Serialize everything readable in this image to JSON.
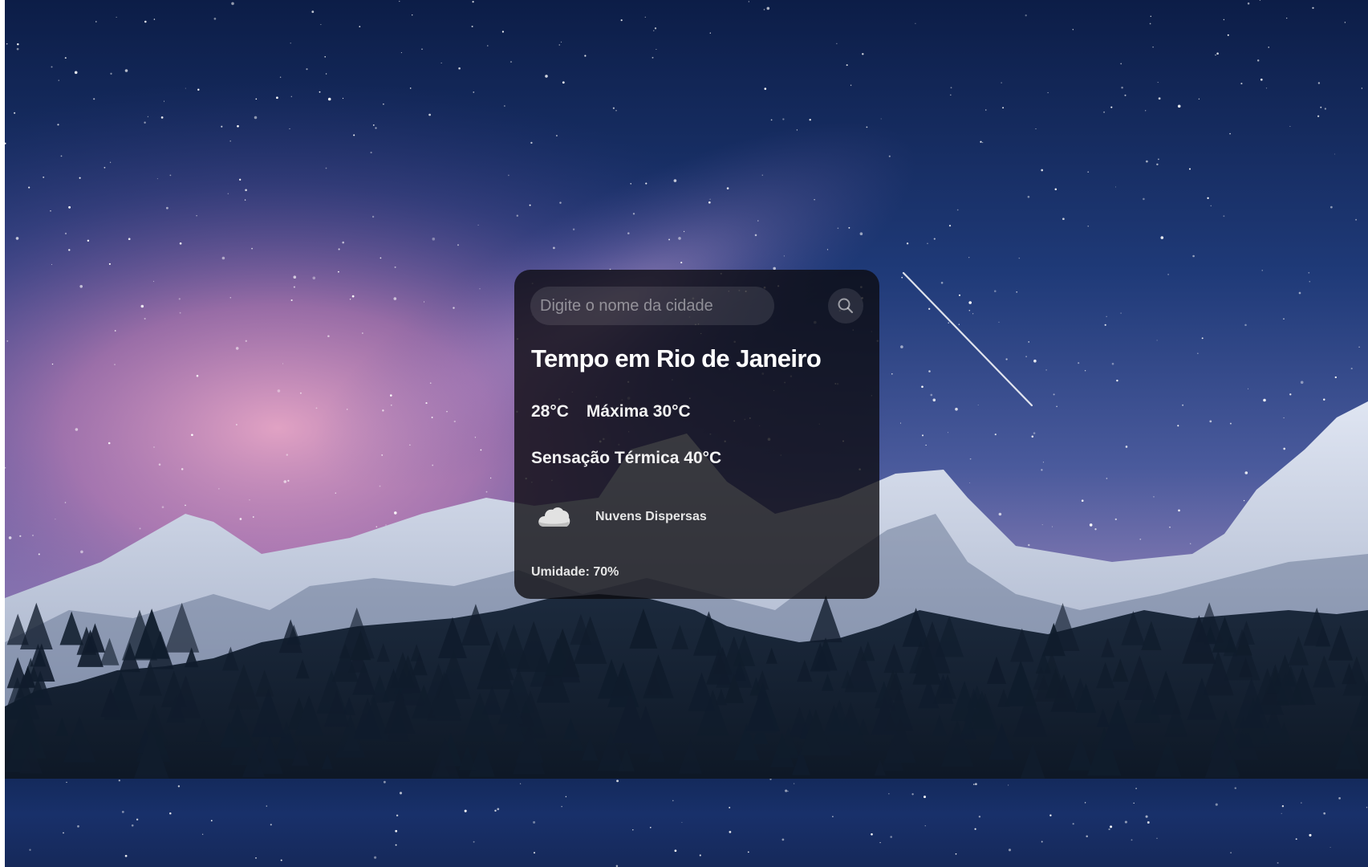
{
  "search": {
    "placeholder": "Digite o nome da cidade",
    "value": "",
    "button_icon": "search-icon"
  },
  "weather": {
    "title": "Tempo em Rio de Janeiro",
    "temperature": "28°C",
    "max_temperature": "Máxima 30°C",
    "feels_like": "Sensação Térmica 40°C",
    "condition_icon": "cloud-icon",
    "condition": "Nuvens Dispersas",
    "humidity": "Umidade: 70%"
  },
  "colors": {
    "card_background": "#0c0a0e",
    "text": "#ffffff",
    "sky_top": "#0d1f4a",
    "sky_glow": "#c97fb3"
  }
}
